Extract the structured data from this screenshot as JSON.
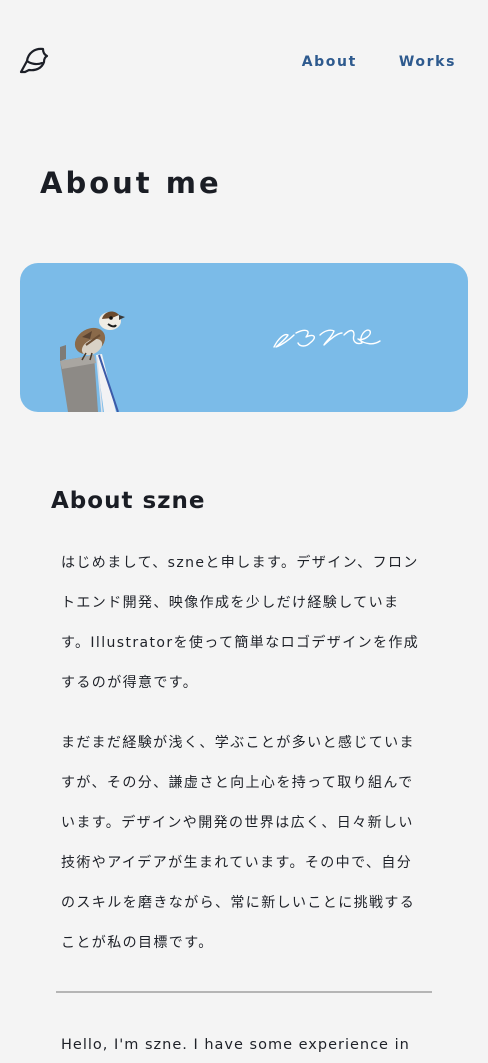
{
  "nav": {
    "items": [
      {
        "label": "About"
      },
      {
        "label": "Works"
      }
    ]
  },
  "page": {
    "title": "About me"
  },
  "hero": {
    "signature_text": "szne",
    "icons": [
      "sparrow-photo",
      "signature-logo"
    ],
    "background_color": "#7bbbe8"
  },
  "about": {
    "heading": "About szne",
    "paragraphs": [
      {
        "lines": [
          "はじめまして、szneと申します。デザイン、フロン",
          "トエンド開発、映像作成を少しだけ経験していま",
          "す。Illustratorを使って簡単なロゴデザインを作成",
          "するのが得意です。"
        ]
      },
      {
        "lines": [
          "まだまだ経験が浅く、学ぶことが多いと感じていま",
          "すが、その分、謙虚さと向上心を持って取り組んで",
          "います。デザインや開発の世界は広く、日々新しい",
          "技術やアイデアが生まれています。その中で、自分",
          "のスキルを磨きながら、常に新しいことに挑戦する",
          "ことが私の目標です。"
        ]
      }
    ],
    "english_intro": "Hello, I'm szne. I have some experience in"
  },
  "colors": {
    "accent": "#2e5a8e",
    "text": "#1e2128",
    "background": "#f4f4f4",
    "divider": "#b5b5b5"
  }
}
